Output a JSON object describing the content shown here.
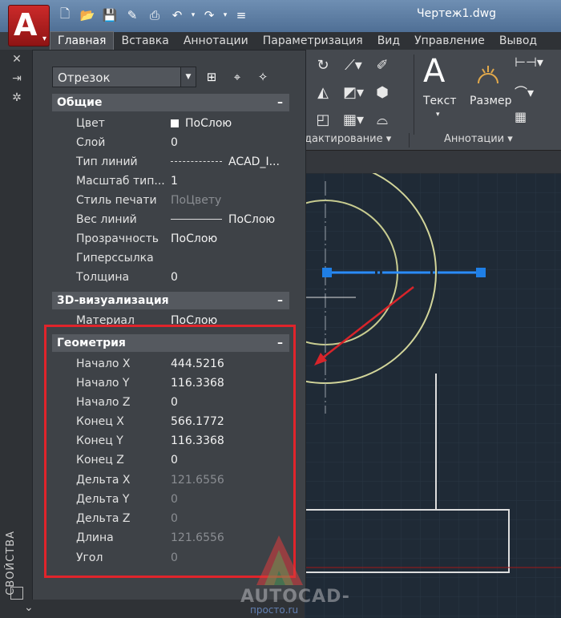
{
  "window": {
    "title": "Чертеж1.dwg"
  },
  "ribbon": {
    "tabs": [
      "Главная",
      "Вставка",
      "Аннотации",
      "Параметризация",
      "Вид",
      "Управление",
      "Вывод"
    ],
    "panels": {
      "modify_title": "дактирование",
      "annotation_title": "Аннотации"
    },
    "buttons": {
      "text": "Текст",
      "dimension": "Размер"
    },
    "big_glyph": "A"
  },
  "palette": {
    "side_title": "СВОЙСТВА",
    "object_selector": "Отрезок",
    "sections": {
      "general": {
        "title": "Общие",
        "rows": [
          {
            "name": "Цвет",
            "value": "ПоСлою"
          },
          {
            "name": "Слой",
            "value": "0"
          },
          {
            "name": "Тип линий",
            "value": "ACAD_I..."
          },
          {
            "name": "Масштаб тип...",
            "value": "1"
          },
          {
            "name": "Стиль печати",
            "value": "ПоЦвету"
          },
          {
            "name": "Вес линий",
            "value": "ПоСлою"
          },
          {
            "name": "Прозрачность",
            "value": "ПоСлою"
          },
          {
            "name": "Гиперссылка",
            "value": ""
          },
          {
            "name": "Толщина",
            "value": "0"
          }
        ]
      },
      "viz3d": {
        "title": "3D-визуализация",
        "rows": [
          {
            "name": "Материал",
            "value": "ПоСлою"
          }
        ]
      },
      "geometry": {
        "title": "Геометрия",
        "rows": [
          {
            "name": "Начало X",
            "value": "444.5216"
          },
          {
            "name": "Начало Y",
            "value": "116.3368"
          },
          {
            "name": "Начало Z",
            "value": "0"
          },
          {
            "name": "Конец X",
            "value": "566.1772"
          },
          {
            "name": "Конец Y",
            "value": "116.3368"
          },
          {
            "name": "Конец Z",
            "value": "0"
          },
          {
            "name": "Дельта X",
            "value": "121.6556"
          },
          {
            "name": "Дельта Y",
            "value": "0"
          },
          {
            "name": "Дельта Z",
            "value": "0"
          },
          {
            "name": "Длина",
            "value": "121.6556"
          },
          {
            "name": "Угол",
            "value": "0"
          }
        ]
      }
    }
  },
  "watermark": {
    "line1": "AUTOCAD-",
    "line2": "просто.ru"
  },
  "colors": {
    "highlight": "#e0242b",
    "arrow": "#d8242a",
    "selected_line": "#2a8cff",
    "circle": "#d2d59a"
  }
}
